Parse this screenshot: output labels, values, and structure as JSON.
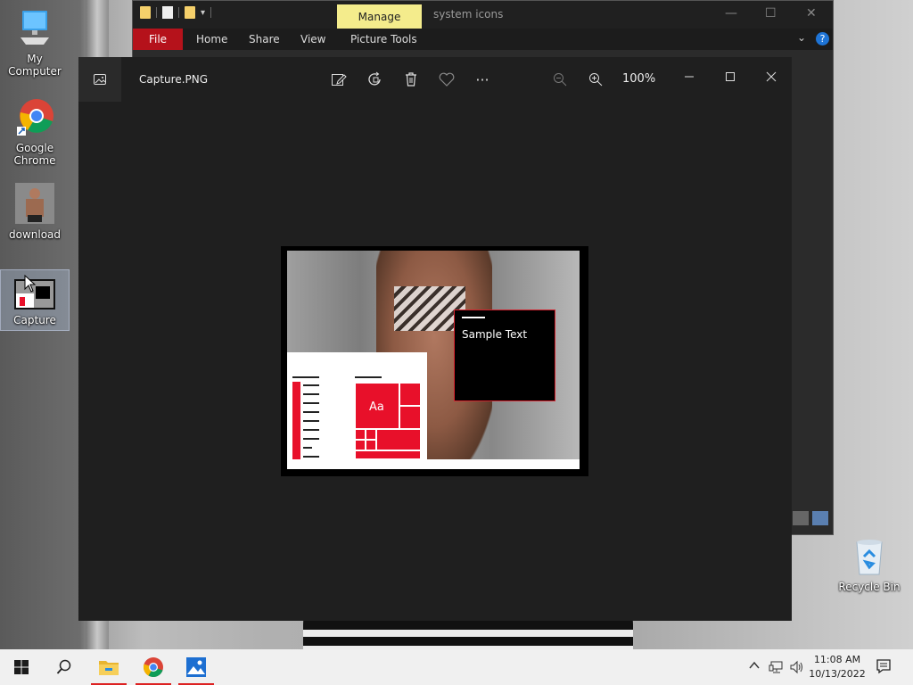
{
  "desktop": {
    "icons": [
      {
        "label": "My Computer",
        "icon": "computer-icon"
      },
      {
        "label": "Google Chrome",
        "icon": "chrome-icon"
      },
      {
        "label": "download",
        "icon": "image-file-icon"
      },
      {
        "label": "Capture",
        "icon": "image-file-icon"
      },
      {
        "label": "Recycle Bin",
        "icon": "recycle-bin-icon"
      }
    ]
  },
  "explorer": {
    "contextual_tab": "Manage",
    "title": "system icons",
    "ribbon_tabs": [
      "File",
      "Home",
      "Share",
      "View",
      "Picture Tools"
    ],
    "help": "?"
  },
  "photos": {
    "title": "Capture.PNG",
    "zoom": "100%",
    "toolbar": [
      "edit-icon",
      "rotate-icon",
      "delete-icon",
      "favorite-icon",
      "more-icon",
      "zoom-out-icon",
      "zoom-in-icon"
    ],
    "image": {
      "card_text": "Sample Text",
      "tile_text": "Aa"
    }
  },
  "taskbar": {
    "apps": [
      "start-icon",
      "search-icon",
      "file-explorer-icon",
      "chrome-icon",
      "photos-icon"
    ],
    "time": "11:08 AM",
    "date": "10/13/2022"
  },
  "colors": {
    "accent_red": "#b5121b",
    "manage_highlight": "#f4ec8c",
    "viewer_bg": "#1f1f1f"
  }
}
